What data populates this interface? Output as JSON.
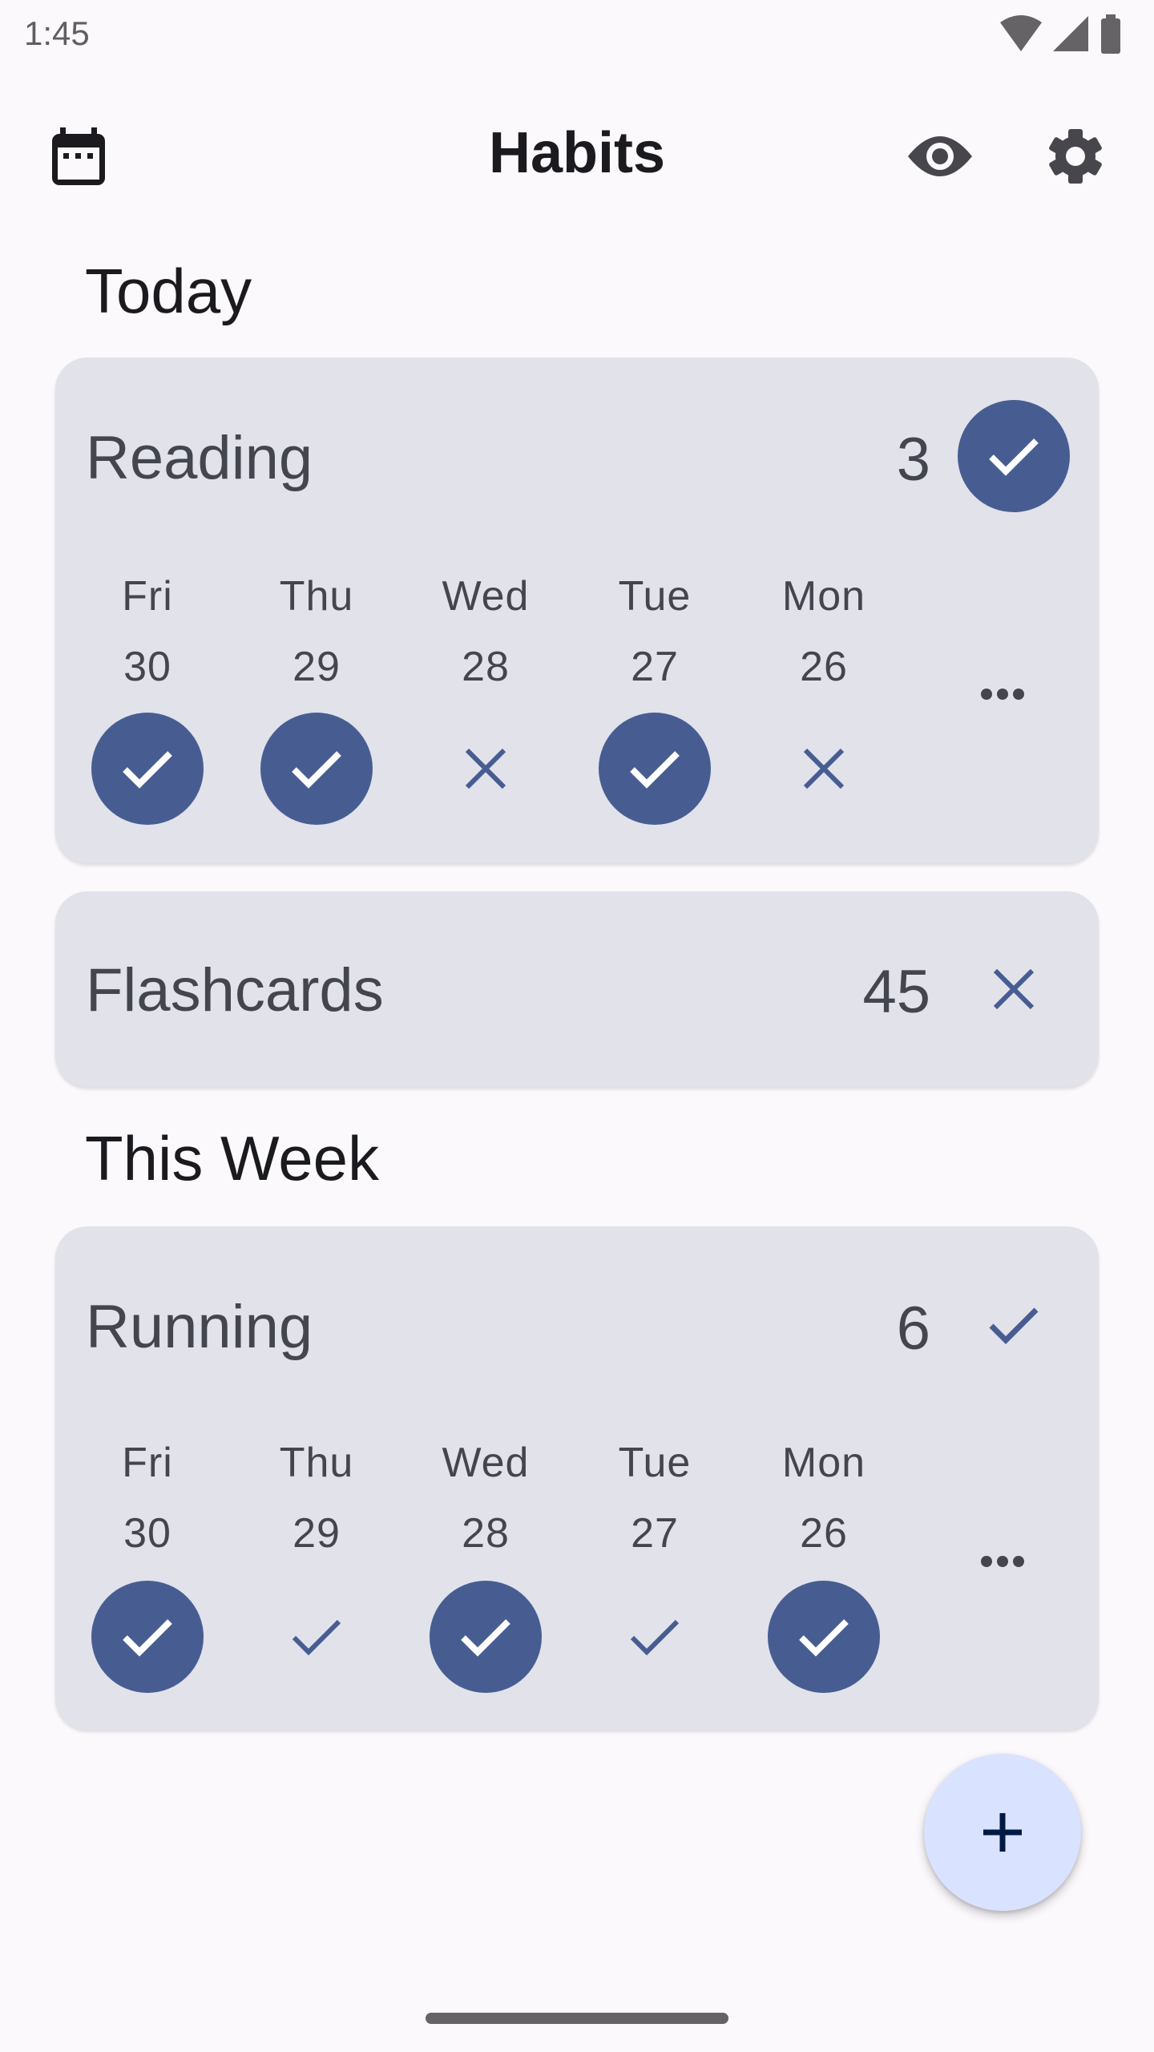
{
  "status_bar": {
    "time": "1:45",
    "icons": [
      "wifi-icon",
      "signal-icon",
      "battery-icon"
    ]
  },
  "app_bar": {
    "title": "Habits",
    "left_icon": "calendar-icon",
    "right_icons": [
      "eye-icon",
      "gear-icon"
    ]
  },
  "colors": {
    "background": "#fcf9fd",
    "card": "#e1e2ea",
    "accent": "#475d92",
    "text_secondary": "#44464f",
    "fab": "#d9e2ff",
    "fab_icon": "#001945"
  },
  "sections": [
    {
      "title": "Today",
      "habits": [
        {
          "name": "Reading",
          "count": "3",
          "today_status": "done",
          "expanded": true,
          "days": [
            {
              "label": "Fri",
              "date": "30",
              "status": "done"
            },
            {
              "label": "Thu",
              "date": "29",
              "status": "done"
            },
            {
              "label": "Wed",
              "date": "28",
              "status": "missed"
            },
            {
              "label": "Tue",
              "date": "27",
              "status": "done"
            },
            {
              "label": "Mon",
              "date": "26",
              "status": "missed"
            }
          ]
        },
        {
          "name": "Flashcards",
          "count": "45",
          "today_status": "missed",
          "expanded": false
        }
      ]
    },
    {
      "title": "This Week",
      "habits": [
        {
          "name": "Running",
          "count": "6",
          "today_status": "partial",
          "expanded": true,
          "days": [
            {
              "label": "Fri",
              "date": "30",
              "status": "done"
            },
            {
              "label": "Thu",
              "date": "29",
              "status": "partial"
            },
            {
              "label": "Wed",
              "date": "28",
              "status": "done"
            },
            {
              "label": "Tue",
              "date": "27",
              "status": "partial"
            },
            {
              "label": "Mon",
              "date": "26",
              "status": "done"
            }
          ]
        }
      ]
    }
  ],
  "fab": {
    "icon": "plus-icon",
    "label": "Add habit"
  }
}
